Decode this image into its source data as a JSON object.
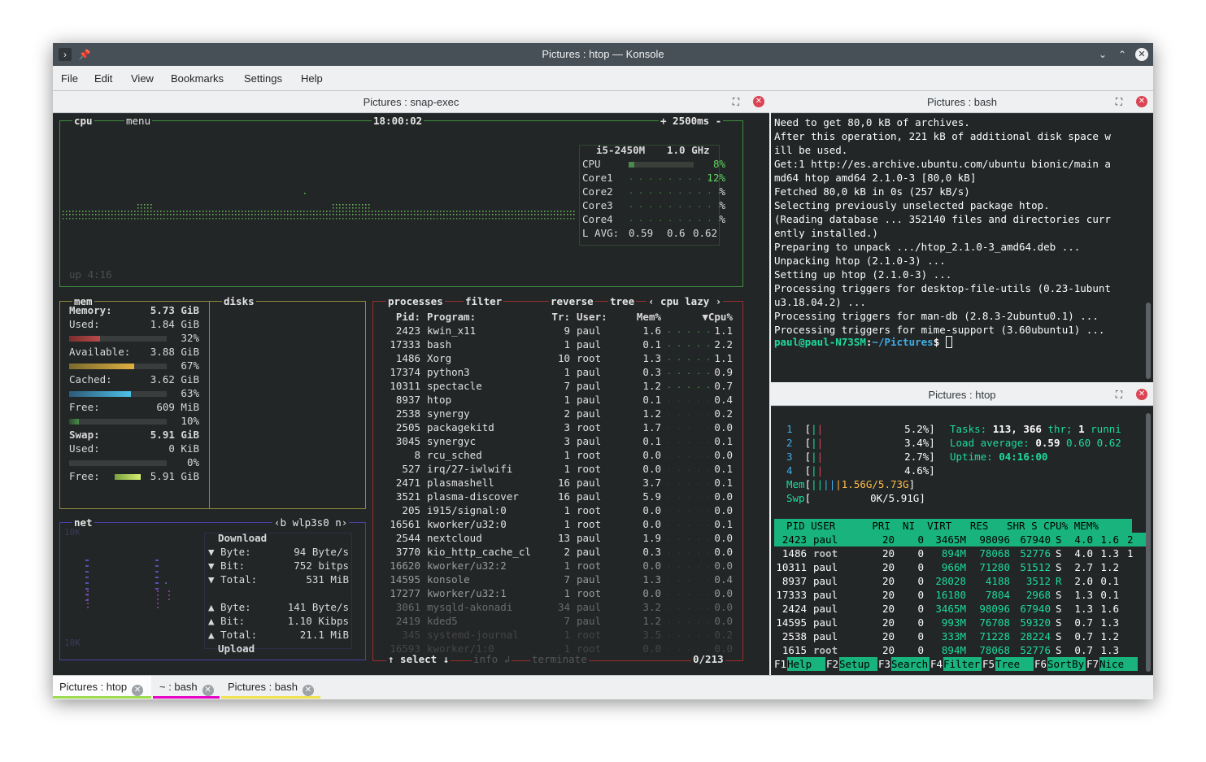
{
  "window": {
    "title": "Pictures : htop — Konsole"
  },
  "menu": [
    "File",
    "Edit",
    "View",
    "Bookmarks",
    "Settings",
    "Help"
  ],
  "panes": {
    "left": "Pictures : snap-exec",
    "bash": "Pictures : bash",
    "htop": "Pictures : htop"
  },
  "bpytop": {
    "cpu": {
      "label": "cpu",
      "menu": "menu",
      "clock": "18:00:02",
      "speed": "+ 2500ms -",
      "model": "i5-2450M",
      "freq": "1.0 GHz",
      "rows": [
        {
          "name": "CPU",
          "pct": "8%"
        },
        {
          "name": "Core1",
          "pct": "12%"
        },
        {
          "name": "Core2",
          "pct": "%"
        },
        {
          "name": "Core3",
          "pct": "%"
        },
        {
          "name": "Core4",
          "pct": "%"
        }
      ],
      "lavg_label": "L AVG:",
      "lavg": [
        "0.59",
        "0.6",
        "0.62"
      ],
      "uptime": "up 4:16"
    },
    "mem": {
      "label": "mem",
      "disks": "disks",
      "rows": [
        {
          "k": "Memory:",
          "v": "5.73 GiB",
          "bold": true
        },
        {
          "k": "Used:",
          "v": "1.84 GiB"
        },
        {
          "k": "",
          "v": "32%",
          "bar": "used"
        },
        {
          "k": "Available:",
          "v": "3.88 GiB"
        },
        {
          "k": "",
          "v": "67%",
          "bar": "avail"
        },
        {
          "k": "Cached:",
          "v": "3.62 GiB"
        },
        {
          "k": "",
          "v": "63%",
          "bar": "cached"
        },
        {
          "k": "Free:",
          "v": "609 MiB"
        },
        {
          "k": "",
          "v": "10%",
          "bar": "free"
        },
        {
          "k": "Swap:",
          "v": "5.91 GiB",
          "bold": true
        },
        {
          "k": "Used:",
          "v": "0 KiB"
        },
        {
          "k": "",
          "v": "0%",
          "bar": "none"
        },
        {
          "k": "Free:",
          "v": "5.91 GiB",
          "bar": "swapfree"
        }
      ]
    },
    "net": {
      "label": "net",
      "iface": "‹b wlp3s0 n›",
      "top": "10K",
      "bottom": "10K",
      "download": "Download",
      "upload": "Upload",
      "down": [
        {
          "k": "▼ Byte:",
          "v": "94 Byte/s"
        },
        {
          "k": "▼ Bit:",
          "v": "752 bitps"
        },
        {
          "k": "▼ Total:",
          "v": "531 MiB"
        }
      ],
      "up": [
        {
          "k": "▲ Byte:",
          "v": "141 Byte/s"
        },
        {
          "k": "▲ Bit:",
          "v": "1.10 Kibps"
        },
        {
          "k": "▲ Total:",
          "v": "21.1 MiB"
        }
      ]
    },
    "proc": {
      "label": "processes",
      "filter": "filter",
      "reverse": "reverse",
      "tree": "tree",
      "sort": "‹ cpu lazy ›",
      "headers": [
        "Pid:",
        "Program:",
        "Tr:",
        "User:",
        "Mem%",
        "▼Cpu%"
      ],
      "footer": {
        "select": "↑ select ↓",
        "info": "info ↲",
        "terminate": "terminate",
        "count": "0/213"
      },
      "rows": [
        [
          "2423",
          "kwin_x11",
          "9",
          "paul",
          "1.6",
          "1.1"
        ],
        [
          "17333",
          "bash",
          "1",
          "paul",
          "0.1",
          "2.2"
        ],
        [
          "1486",
          "Xorg",
          "10",
          "root",
          "1.3",
          "1.1"
        ],
        [
          "17374",
          "python3",
          "1",
          "paul",
          "0.3",
          "0.9"
        ],
        [
          "10311",
          "spectacle",
          "7",
          "paul",
          "1.2",
          "0.7"
        ],
        [
          "8937",
          "htop",
          "1",
          "paul",
          "0.1",
          "0.4"
        ],
        [
          "2538",
          "synergy",
          "2",
          "paul",
          "1.2",
          "0.2"
        ],
        [
          "2505",
          "packagekitd",
          "3",
          "root",
          "1.7",
          "0.0"
        ],
        [
          "3045",
          "synergyc",
          "3",
          "paul",
          "0.1",
          "0.1"
        ],
        [
          "8",
          "rcu_sched",
          "1",
          "root",
          "0.0",
          "0.0"
        ],
        [
          "527",
          "irq/27-iwlwifi",
          "1",
          "root",
          "0.0",
          "0.1"
        ],
        [
          "2471",
          "plasmashell",
          "16",
          "paul",
          "3.7",
          "0.1"
        ],
        [
          "3521",
          "plasma-discover",
          "16",
          "paul",
          "5.9",
          "0.0"
        ],
        [
          "205",
          "i915/signal:0",
          "1",
          "root",
          "0.0",
          "0.0"
        ],
        [
          "16561",
          "kworker/u32:0",
          "1",
          "root",
          "0.0",
          "0.1"
        ],
        [
          "2544",
          "nextcloud",
          "13",
          "paul",
          "1.9",
          "0.0"
        ],
        [
          "3770",
          "kio_http_cache_cl",
          "2",
          "paul",
          "0.3",
          "0.0"
        ],
        [
          "16620",
          "kworker/u32:2",
          "1",
          "root",
          "0.0",
          "0.0"
        ],
        [
          "14595",
          "konsole",
          "7",
          "paul",
          "1.3",
          "0.4"
        ],
        [
          "17277",
          "kworker/u32:1",
          "1",
          "root",
          "0.0",
          "0.0"
        ],
        [
          "3061",
          "mysqld-akonadi",
          "34",
          "paul",
          "3.2",
          "0.0"
        ],
        [
          "2419",
          "kded5",
          "7",
          "paul",
          "1.2",
          "0.0"
        ],
        [
          "345",
          "systemd-journal",
          "1",
          "root",
          "3.5",
          "0.2"
        ],
        [
          "16593",
          "kworker/1:0",
          "1",
          "root",
          "0.0",
          "0.0"
        ]
      ]
    }
  },
  "bash": {
    "lines": [
      "Need to get 80,0 kB of archives.",
      "After this operation, 221 kB of additional disk space w",
      "ill be used.",
      "Get:1 http://es.archive.ubuntu.com/ubuntu bionic/main a",
      "md64 htop amd64 2.1.0-3 [80,0 kB]",
      "Fetched 80,0 kB in 0s (257 kB/s)",
      "Selecting previously unselected package htop.",
      "(Reading database ... 352140 files and directories curr",
      "ently installed.)",
      "Preparing to unpack .../htop_2.1.0-3_amd64.deb ...",
      "Unpacking htop (2.1.0-3) ...",
      "Setting up htop (2.1.0-3) ...",
      "Processing triggers for desktop-file-utils (0.23-1ubunt",
      "u3.18.04.2) ...",
      "Processing triggers for man-db (2.8.3-2ubuntu0.1) ...",
      "Processing triggers for mime-support (3.60ubuntu1) ..."
    ],
    "prompt_user": "paul@paul-N73SM",
    "prompt_path": "~/Pictures",
    "prompt_end": "$ "
  },
  "htop": {
    "cpus": [
      {
        "n": "1",
        "p": "5.2%"
      },
      {
        "n": "2",
        "p": "3.4%"
      },
      {
        "n": "3",
        "p": "2.7%"
      },
      {
        "n": "4",
        "p": "4.6%"
      }
    ],
    "mem_label": "Mem",
    "mem_val": "1.56G/5.73G",
    "swp_label": "Swp",
    "swp_val": "0K/5.91G",
    "tasks_label": "Tasks:",
    "tasks": "113,",
    "thr": "366",
    "thr_label": "thr;",
    "running": "1",
    "running_label": "runni",
    "load_label": "Load average:",
    "load": [
      "0.59",
      "0.60",
      "0.62"
    ],
    "uptime_label": "Uptime:",
    "uptime": "04:16:00",
    "header": "  PID USER      PRI  NI  VIRT   RES   SHR S CPU% MEM%",
    "rows": [
      {
        "pid": "2423",
        "user": "paul",
        "pri": "20",
        "ni": "0",
        "virt": "3465M",
        "res": "98096",
        "shr": "67940",
        "s": "S",
        "cpu": "4.0",
        "mem": "1.6",
        "x": "2"
      },
      {
        "pid": "1486",
        "user": "root",
        "pri": "20",
        "ni": "0",
        "virt": "894M",
        "res": "78068",
        "shr": "52776",
        "s": "S",
        "cpu": "4.0",
        "mem": "1.3",
        "x": "1"
      },
      {
        "pid": "10311",
        "user": "paul",
        "pri": "20",
        "ni": "0",
        "virt": "966M",
        "res": "71280",
        "shr": "51512",
        "s": "S",
        "cpu": "2.7",
        "mem": "1.2",
        "x": ""
      },
      {
        "pid": "8937",
        "user": "paul",
        "pri": "20",
        "ni": "0",
        "virt": "28028",
        "res": "4188",
        "shr": "3512",
        "s": "R",
        "cpu": "2.0",
        "mem": "0.1",
        "x": ""
      },
      {
        "pid": "17333",
        "user": "paul",
        "pri": "20",
        "ni": "0",
        "virt": "16180",
        "res": "7804",
        "shr": "2968",
        "s": "S",
        "cpu": "1.3",
        "mem": "0.1",
        "x": ""
      },
      {
        "pid": "2424",
        "user": "paul",
        "pri": "20",
        "ni": "0",
        "virt": "3465M",
        "res": "98096",
        "shr": "67940",
        "s": "S",
        "cpu": "1.3",
        "mem": "1.6",
        "x": ""
      },
      {
        "pid": "14595",
        "user": "paul",
        "pri": "20",
        "ni": "0",
        "virt": "993M",
        "res": "76708",
        "shr": "59320",
        "s": "S",
        "cpu": "0.7",
        "mem": "1.3",
        "x": ""
      },
      {
        "pid": "2538",
        "user": "paul",
        "pri": "20",
        "ni": "0",
        "virt": "333M",
        "res": "71228",
        "shr": "28224",
        "s": "S",
        "cpu": "0.7",
        "mem": "1.2",
        "x": ""
      },
      {
        "pid": "1615",
        "user": "root",
        "pri": "20",
        "ni": "0",
        "virt": "894M",
        "res": "78068",
        "shr": "52776",
        "s": "S",
        "cpu": "0.7",
        "mem": "1.3",
        "x": ""
      }
    ],
    "fkeys": [
      {
        "k": "F1",
        "l": "Help"
      },
      {
        "k": "F2",
        "l": "Setup"
      },
      {
        "k": "F3",
        "l": "Search"
      },
      {
        "k": "F4",
        "l": "Filter"
      },
      {
        "k": "F5",
        "l": "Tree"
      },
      {
        "k": "F6",
        "l": "SortBy"
      },
      {
        "k": "F7",
        "l": "Nice"
      }
    ]
  },
  "tabs": [
    {
      "label": "Pictures : htop",
      "color": "#9bdb4d"
    },
    {
      "label": "~ : bash",
      "color": "#e600c7"
    },
    {
      "label": "Pictures : bash",
      "color": "#f0e14d"
    }
  ],
  "colors": {
    "cpu_box": "#3d8f3d",
    "mem_box": "#8f8a3a",
    "net_box": "#4a3fa5",
    "proc_box": "#9b2d2d",
    "htop_green": "#19b37e"
  }
}
